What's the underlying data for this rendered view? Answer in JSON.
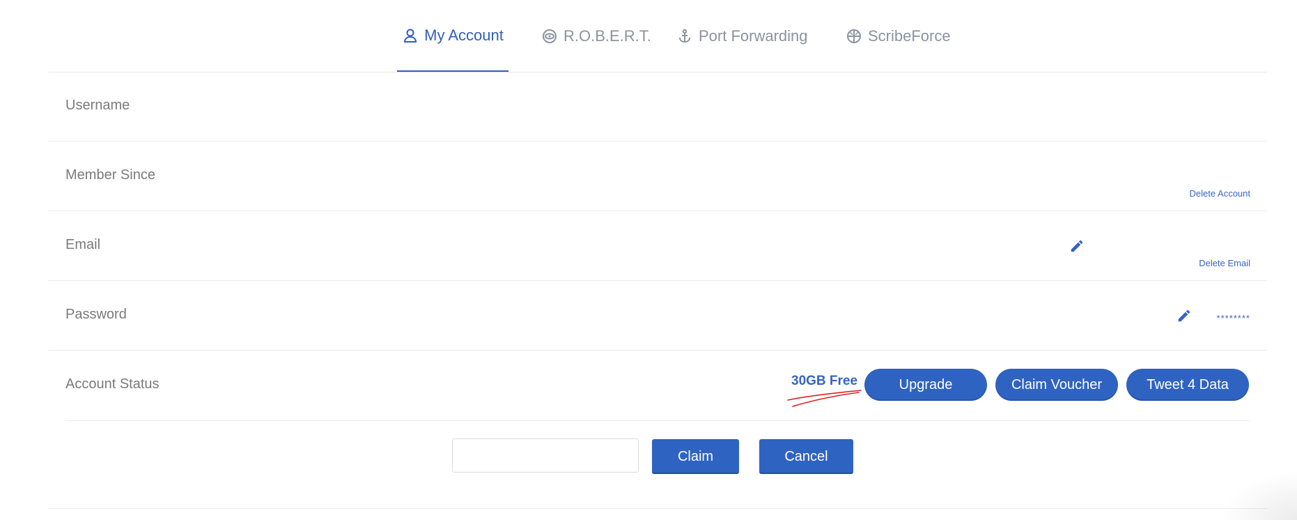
{
  "tabs": [
    {
      "label": "My Account",
      "icon": "user-icon",
      "active": true
    },
    {
      "label": "R.O.B.E.R.T.",
      "icon": "robot-icon",
      "active": false
    },
    {
      "label": "Port Forwarding",
      "icon": "anchor-icon",
      "active": false
    },
    {
      "label": "ScribeForce",
      "icon": "globe-icon",
      "active": false
    }
  ],
  "rows": {
    "username": {
      "label": "Username"
    },
    "member_since": {
      "label": "Member Since",
      "action": "Delete Account"
    },
    "email": {
      "label": "Email",
      "action": "Delete Email"
    },
    "password": {
      "label": "Password",
      "masked": "********"
    },
    "account_status": {
      "label": "Account Status",
      "plan": "30GB Free",
      "buttons": [
        "Upgrade",
        "Claim Voucher",
        "Tweet 4 Data"
      ]
    }
  },
  "voucher": {
    "input_value": "",
    "claim_label": "Claim",
    "cancel_label": "Cancel"
  },
  "colors": {
    "accent": "#2f63c2",
    "tab_inactive": "#8b92a0",
    "label": "#7a7a7a",
    "annotation": "#e02020"
  }
}
